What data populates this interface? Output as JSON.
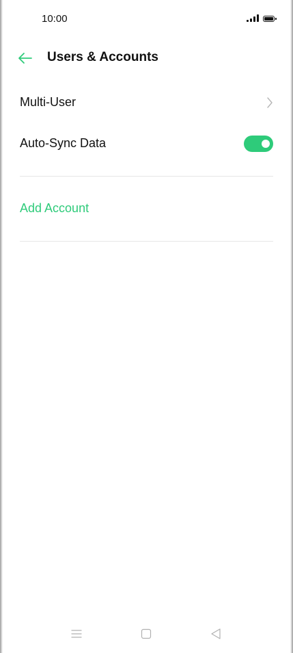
{
  "status_bar": {
    "time": "10:00",
    "signal_icon": "signal-bars-icon",
    "battery_icon": "battery-full-icon"
  },
  "app_bar": {
    "back_icon": "arrow-left-icon",
    "title": "Users & Accounts"
  },
  "settings": {
    "multi_user": {
      "label": "Multi-User",
      "icon": "chevron-right-icon"
    },
    "auto_sync": {
      "label": "Auto-Sync Data",
      "enabled": true
    },
    "add_account": {
      "label": "Add Account"
    }
  },
  "navigation_bar": {
    "menu_icon": "menu-lines-icon",
    "home_icon": "square-home-icon",
    "back_icon": "triangle-back-icon"
  },
  "colors": {
    "accent": "#2ecb7a",
    "text_primary": "#111111",
    "divider": "#e6e6e6",
    "nav_icon": "#b0b0b0"
  }
}
